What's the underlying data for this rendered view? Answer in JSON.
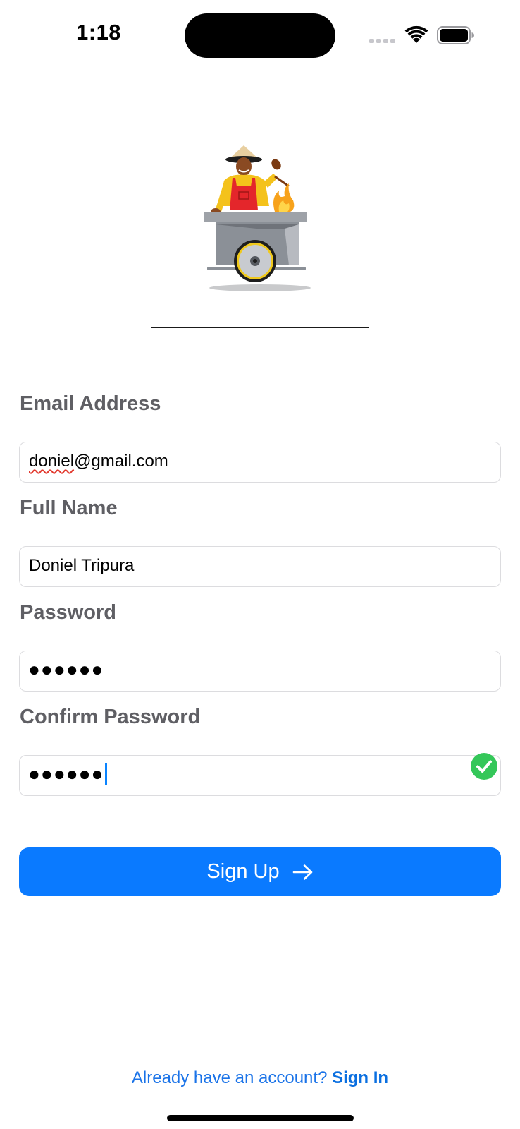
{
  "status_bar": {
    "time": "1:18",
    "icons": [
      "cellular-signal-icon",
      "wifi-icon",
      "battery-icon"
    ]
  },
  "logo": {
    "icon": "street-food-vendor-cart-illustration"
  },
  "form": {
    "email": {
      "label": "Email Address",
      "value_misspelled_part": "doniel",
      "value_rest": "@gmail.com"
    },
    "full_name": {
      "label": "Full Name",
      "value": "Doniel Tripura"
    },
    "password": {
      "label": "Password",
      "masked_value": "●●●●●●"
    },
    "confirm_password": {
      "label": "Confirm Password",
      "masked_value": "●●●●●●",
      "valid": true
    }
  },
  "signup_button": {
    "label": "Sign Up",
    "icon": "arrow-right-icon"
  },
  "footer": {
    "prompt": "Already have an account?",
    "link_label": "Sign In"
  },
  "colors": {
    "primary": "#0a7aff",
    "label_gray": "#5f5f64",
    "valid_green": "#34c759",
    "field_border": "#dcdcdf"
  }
}
